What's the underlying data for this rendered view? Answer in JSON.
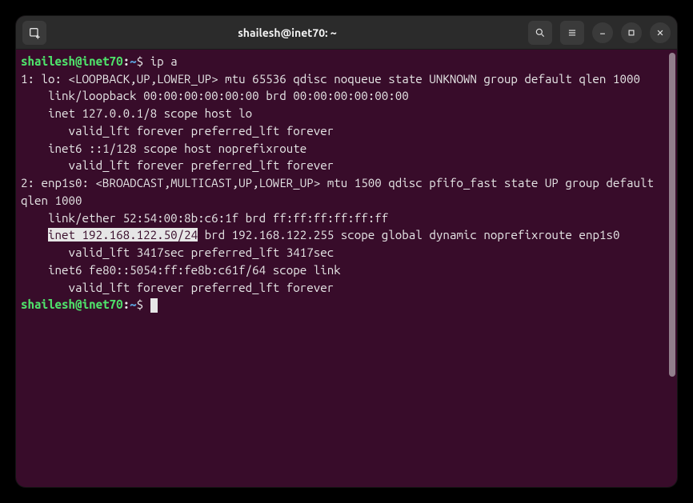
{
  "titlebar": {
    "title": "shailesh@inet70: ~"
  },
  "prompt": {
    "user": "shailesh",
    "at": "@",
    "host": "inet70",
    "colon": ":",
    "path": "~",
    "dollar": "$"
  },
  "command1": "ip a",
  "output": {
    "l1": "1: lo: <LOOPBACK,UP,LOWER_UP> mtu 65536 qdisc noqueue state UNKNOWN group default qlen 1000",
    "l2": "    link/loopback 00:00:00:00:00:00 brd 00:00:00:00:00:00",
    "l3": "    inet 127.0.0.1/8 scope host lo",
    "l4": "       valid_lft forever preferred_lft forever",
    "l5": "    inet6 ::1/128 scope host noprefixroute",
    "l6": "       valid_lft forever preferred_lft forever",
    "l7": "2: enp1s0: <BROADCAST,MULTICAST,UP,LOWER_UP> mtu 1500 qdisc pfifo_fast state UP group default qlen 1000",
    "l8": "    link/ether 52:54:00:8b:c6:1f brd ff:ff:ff:ff:ff:ff",
    "l9a": "    ",
    "l9hl": "inet 192.168.122.50/24",
    "l9b": " brd 192.168.122.255 scope global dynamic noprefixroute enp1s0",
    "l10": "       valid_lft 3417sec preferred_lft 3417sec",
    "l11": "    inet6 fe80::5054:ff:fe8b:c61f/64 scope link",
    "l12": "       valid_lft forever preferred_lft forever"
  }
}
